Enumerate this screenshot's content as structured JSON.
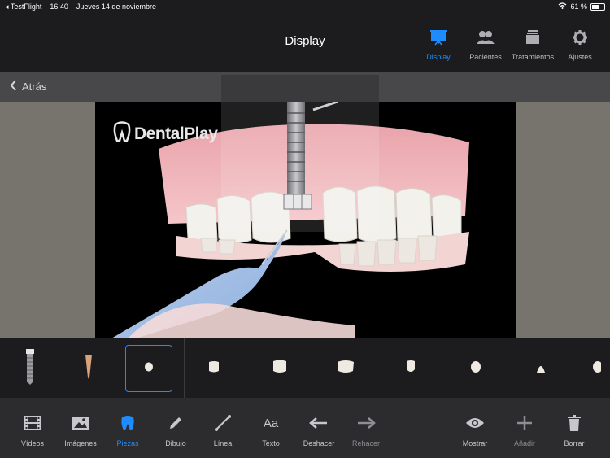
{
  "status": {
    "app": "TestFlight",
    "time": "16:40",
    "date": "Jueves 14 de noviembre",
    "battery": "61 %"
  },
  "nav": {
    "title": "Display",
    "tabs": [
      {
        "label": "Display",
        "icon": "presentation-icon",
        "active": true
      },
      {
        "label": "Pacientes",
        "icon": "patients-icon",
        "active": false
      },
      {
        "label": "Tratamientos",
        "icon": "treatments-icon",
        "active": false
      },
      {
        "label": "Ajustes",
        "icon": "gear-icon",
        "active": false
      }
    ]
  },
  "subbar": {
    "back_label": "Atrás"
  },
  "video": {
    "logo_text": "DentalPlay"
  },
  "pieces": [
    {
      "name": "implant",
      "selected": false
    },
    {
      "name": "root",
      "selected": false
    },
    {
      "name": "small-tooth",
      "selected": true
    },
    {
      "name": "premolar",
      "selected": false
    },
    {
      "name": "molar",
      "selected": false
    },
    {
      "name": "molar-wide",
      "selected": false
    },
    {
      "name": "canine",
      "selected": false
    },
    {
      "name": "incisor",
      "selected": false
    },
    {
      "name": "central-incisor",
      "selected": false
    },
    {
      "name": "tooth-partial",
      "selected": false
    }
  ],
  "toolbar": {
    "tools": [
      {
        "label": "Vídeos",
        "icon": "film-icon",
        "state": "normal"
      },
      {
        "label": "Imágenes",
        "icon": "image-icon",
        "state": "normal"
      },
      {
        "label": "Piezas",
        "icon": "tooth-icon",
        "state": "active"
      },
      {
        "label": "Dibujo",
        "icon": "pencil-icon",
        "state": "normal"
      },
      {
        "label": "Línea",
        "icon": "line-icon",
        "state": "normal"
      },
      {
        "label": "Texto",
        "icon": "text-icon",
        "state": "normal"
      },
      {
        "label": "Deshacer",
        "icon": "undo-arrow-icon",
        "state": "normal"
      },
      {
        "label": "Rehacer",
        "icon": "redo-arrow-icon",
        "state": "disabled"
      },
      {
        "label": "Mostrar",
        "icon": "eye-icon",
        "state": "normal"
      },
      {
        "label": "Añadir",
        "icon": "plus-icon",
        "state": "disabled"
      },
      {
        "label": "Borrar",
        "icon": "trash-icon",
        "state": "normal"
      }
    ]
  },
  "colors": {
    "accent": "#1e8cff",
    "background": "#1c1c1e",
    "toolbar": "#2c2c2e"
  }
}
